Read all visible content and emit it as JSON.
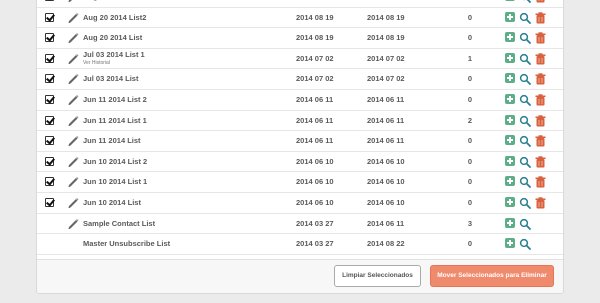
{
  "rows": [
    {
      "checked": true,
      "name": "Aug 20 2014 List3",
      "sub": "",
      "created": "2014 08 19",
      "modified": "2014 08 19",
      "count": "0",
      "deletable": true
    },
    {
      "checked": true,
      "name": "Aug 20 2014 List2",
      "sub": "",
      "created": "2014 08 19",
      "modified": "2014 08 19",
      "count": "0",
      "deletable": true
    },
    {
      "checked": true,
      "name": "Aug 20 2014 List",
      "sub": "",
      "created": "2014 08 19",
      "modified": "2014 08 19",
      "count": "0",
      "deletable": true
    },
    {
      "checked": true,
      "name": "Jul 03 2014 List 1",
      "sub": "Ver Historial",
      "created": "2014 07 02",
      "modified": "2014 07 02",
      "count": "1",
      "deletable": true
    },
    {
      "checked": true,
      "name": "Jul 03 2014 List",
      "sub": "",
      "created": "2014 07 02",
      "modified": "2014 07 02",
      "count": "0",
      "deletable": true
    },
    {
      "checked": true,
      "name": "Jun 11 2014 List 2",
      "sub": "",
      "created": "2014 06 11",
      "modified": "2014 06 11",
      "count": "0",
      "deletable": true
    },
    {
      "checked": true,
      "name": "Jun 11 2014 List 1",
      "sub": "",
      "created": "2014 06 11",
      "modified": "2014 06 11",
      "count": "2",
      "deletable": true
    },
    {
      "checked": true,
      "name": "Jun 11 2014 List",
      "sub": "",
      "created": "2014 06 11",
      "modified": "2014 06 11",
      "count": "0",
      "deletable": true
    },
    {
      "checked": true,
      "name": "Jun 10 2014 List 2",
      "sub": "",
      "created": "2014 06 10",
      "modified": "2014 06 10",
      "count": "0",
      "deletable": true
    },
    {
      "checked": true,
      "name": "Jun 10 2014 List 1",
      "sub": "",
      "created": "2014 06 10",
      "modified": "2014 06 10",
      "count": "0",
      "deletable": true
    },
    {
      "checked": true,
      "name": "Jun 10 2014 List",
      "sub": "",
      "created": "2014 06 10",
      "modified": "2014 06 10",
      "count": "0",
      "deletable": true
    },
    {
      "checked": false,
      "name": "Sample Contact List",
      "sub": "",
      "created": "2014 03 27",
      "modified": "2014 06 11",
      "count": "3",
      "deletable": false,
      "editable": true
    },
    {
      "checked": false,
      "name": "Master Unsubscribe List",
      "sub": "",
      "created": "2014 03 27",
      "modified": "2014 08 22",
      "count": "0",
      "deletable": false,
      "editable": false
    }
  ],
  "actions": {
    "clear_label": "Limpiar Seleccionados",
    "move_label": "Mover Seleccionados para Eliminar"
  },
  "icons": {
    "edit": "pencil-icon",
    "add": "add-contact-icon",
    "view": "search-icon",
    "delete": "trash-icon"
  },
  "colors": {
    "add_green": "#5cae88",
    "search_teal": "#2b7f93",
    "trash_orange": "#d9613e",
    "move_button": "#f08a6c"
  }
}
